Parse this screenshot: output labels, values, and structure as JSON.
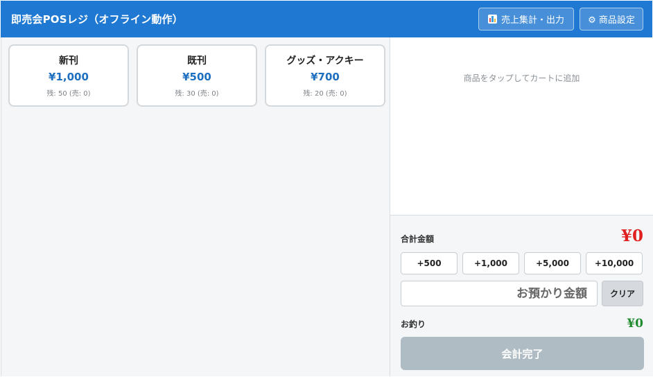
{
  "header": {
    "title": "即売会POSレジ（オフライン動作）",
    "sales_label": "売上集計・出力",
    "settings_label": "⚙ 商品設定"
  },
  "products": [
    {
      "name": "新刊",
      "price": "¥1,000",
      "stock": "残: 50 (売: 0)"
    },
    {
      "name": "既刊",
      "price": "¥500",
      "stock": "残: 30 (売: 0)"
    },
    {
      "name": "グッズ・アクキー",
      "price": "¥700",
      "stock": "残: 20 (売: 0)"
    }
  ],
  "cart": {
    "empty_message": "商品をタップしてカートに追加"
  },
  "checkout": {
    "total_label": "合計金額",
    "total_value": "¥0",
    "quick_amounts": [
      "+500",
      "+1,000",
      "+5,000",
      "+10,000"
    ],
    "tender_placeholder": "お預かり金額",
    "tender_value": "",
    "clear_label": "クリア",
    "change_label": "お釣り",
    "change_value": "¥0",
    "complete_label": "会計完了"
  },
  "colors": {
    "header_bg": "#1f78d1",
    "price": "#1f6fc0",
    "total": "#e02020",
    "change": "#1f8a2e",
    "complete_disabled": "#b0bcc4"
  }
}
